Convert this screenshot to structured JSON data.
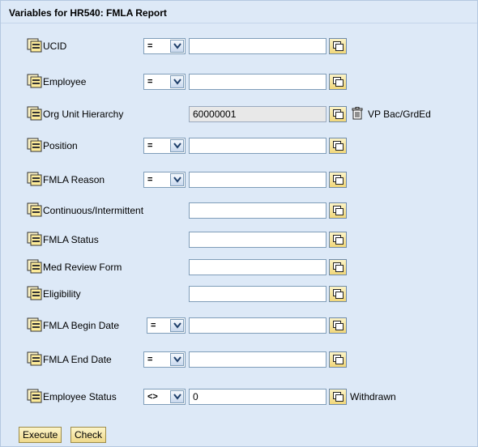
{
  "title": "Variables for HR540: FMLA Report",
  "rows": [
    {
      "label": "UCID",
      "operator": "=",
      "value": "",
      "extra": ""
    },
    {
      "label": "Employee",
      "operator": "=",
      "value": "",
      "extra": ""
    },
    {
      "label": "Org Unit Hierarchy",
      "operator": "",
      "value": "60000001",
      "extra": "VP Bac/GrdEd"
    },
    {
      "label": "Position",
      "operator": "=",
      "value": "",
      "extra": ""
    },
    {
      "label": "FMLA Reason",
      "operator": "=",
      "value": "",
      "extra": ""
    },
    {
      "label": "Continuous/Intermittent",
      "operator": "",
      "value": "",
      "extra": ""
    },
    {
      "label": "FMLA Status",
      "operator": "",
      "value": "",
      "extra": ""
    },
    {
      "label": "Med Review Form",
      "operator": "",
      "value": "",
      "extra": ""
    },
    {
      "label": "Eligibility",
      "operator": "",
      "value": "",
      "extra": ""
    },
    {
      "label": "FMLA Begin Date",
      "operator": "=",
      "value": "",
      "extra": ""
    },
    {
      "label": "FMLA End Date",
      "operator": "=",
      "value": "",
      "extra": ""
    },
    {
      "label": "Employee Status",
      "operator": "<>",
      "value": "0",
      "extra": "Withdrawn"
    }
  ],
  "buttons": {
    "execute": "Execute",
    "check": "Check"
  },
  "icons": {
    "row": "hierarchy-icon",
    "f4": "value-help-icon",
    "delete": "trash-icon"
  },
  "colors": {
    "panel": "#dde9f7",
    "button": "#f1d77a",
    "border": "#7f9db9"
  }
}
